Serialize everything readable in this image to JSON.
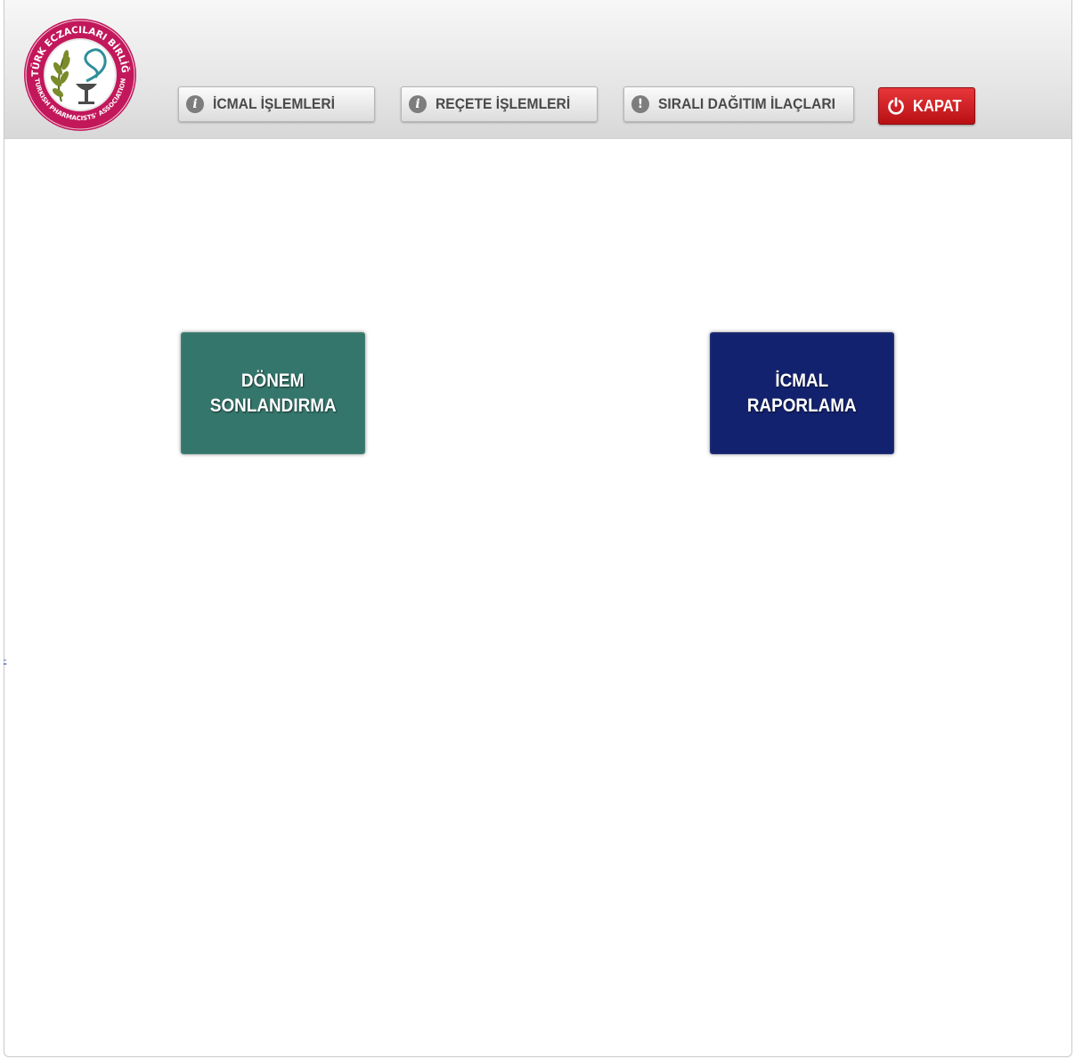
{
  "header": {
    "logo": {
      "top_text": "TÜRK ECZACILARI BİRLİĞİ",
      "bottom_text": "TURKISH PHARMACISTS' ASSOCIATION"
    },
    "nav": [
      {
        "label": "İCMAL İŞLEMLERİ",
        "icon": "info-icon"
      },
      {
        "label": "REÇETE İŞLEMLERİ",
        "icon": "info-icon"
      },
      {
        "label": "SIRALI DAĞITIM İLAÇLARI",
        "icon": "alert-icon"
      }
    ],
    "close_button": {
      "label": "KAPAT",
      "icon": "power-icon"
    }
  },
  "tiles": [
    {
      "line1": "DÖNEM",
      "line2": "SONLANDIRMA",
      "color": "#34766b"
    },
    {
      "line1": "İCMAL",
      "line2": "RAPORLAMA",
      "color": "#13226e"
    }
  ],
  "side_link": "-",
  "colors": {
    "accent_red": "#c81a1e",
    "logo_ring": "#c2185b"
  }
}
